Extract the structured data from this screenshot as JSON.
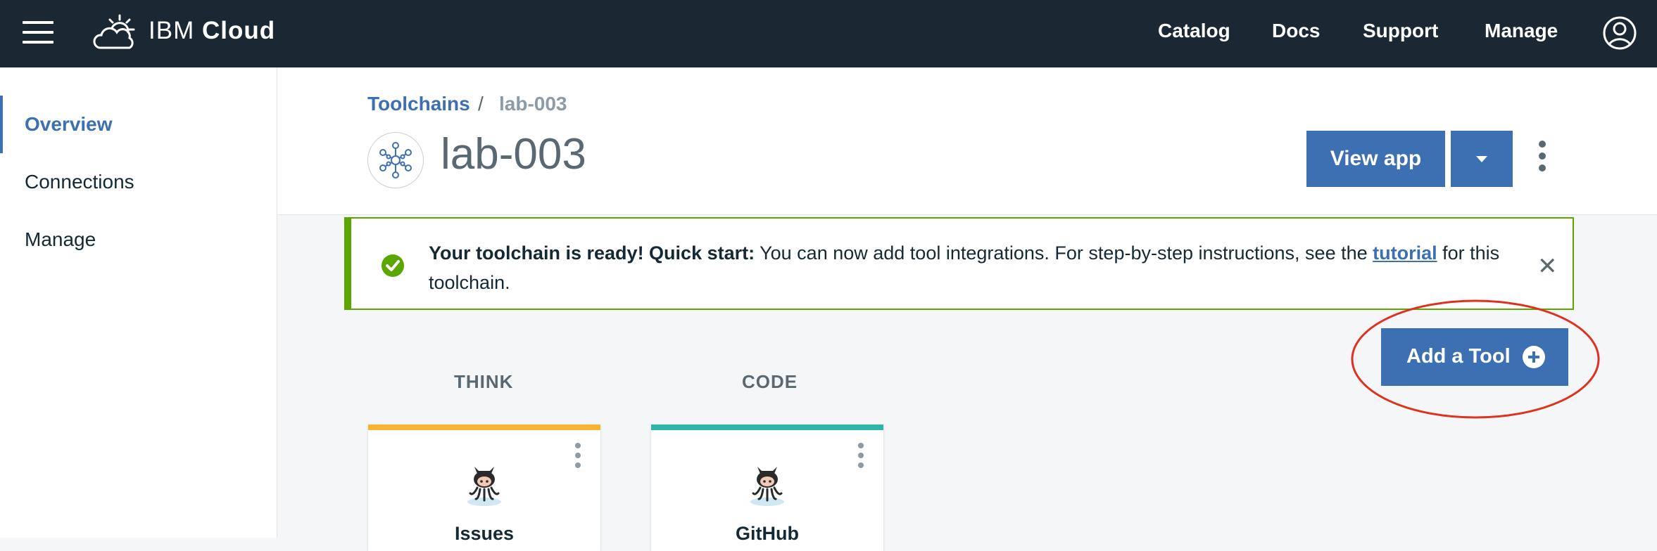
{
  "topbar": {
    "brand_prefix": "IBM",
    "brand_name": "Cloud",
    "nav": [
      "Catalog",
      "Docs",
      "Support",
      "Manage"
    ]
  },
  "sidebar": {
    "items": [
      {
        "label": "Overview",
        "active": true
      },
      {
        "label": "Connections",
        "active": false
      },
      {
        "label": "Manage",
        "active": false
      }
    ]
  },
  "header": {
    "breadcrumb": {
      "parent": "Toolchains",
      "separator": "/",
      "current": "lab-003"
    },
    "title": "lab-003",
    "view_app_label": "View app"
  },
  "notification": {
    "bold_text": "Your toolchain is ready! Quick start:",
    "text_before_link": " You can now add tool integrations. For step-by-step instructions, see the ",
    "link_text": "tutorial",
    "text_after_link": " for this toolchain.",
    "close_symbol": "✕"
  },
  "add_tool_label": "Add a Tool",
  "phases": [
    {
      "label": "THINK",
      "card_label": "Issues",
      "color": "#f5b530"
    },
    {
      "label": "CODE",
      "card_label": "GitHub",
      "color": "#2fb4a8"
    }
  ],
  "colors": {
    "accent": "#3d70b2",
    "topbar": "#1b2834",
    "success": "#5aa700",
    "annotation": "#e0301e"
  }
}
